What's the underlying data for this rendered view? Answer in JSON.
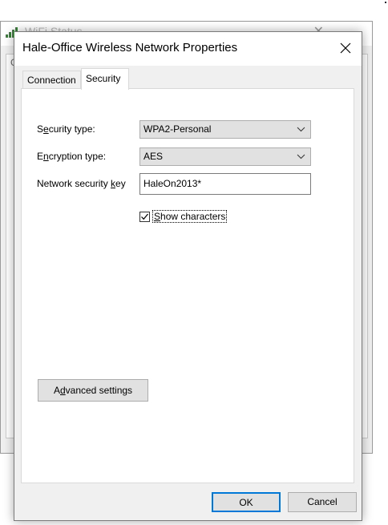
{
  "background_window": {
    "title": "WiFi Status",
    "tab_letter": "G"
  },
  "dialog": {
    "title": "Hale-Office Wireless Network Properties",
    "tabs": [
      {
        "label": "Connection",
        "selected": false
      },
      {
        "label": "Security",
        "selected": true
      }
    ],
    "security_type": {
      "label_pre": "S",
      "label_key": "e",
      "label_post": "curity type:",
      "value": "WPA2-Personal"
    },
    "encryption_type": {
      "label_pre": "E",
      "label_key": "n",
      "label_post": "cryption type:",
      "value": "AES"
    },
    "network_key": {
      "label_pre": "Network security ",
      "label_key": "k",
      "label_post": "ey",
      "value": "HaleOn2013*"
    },
    "show_characters": {
      "label_key": "S",
      "label_post": "how characters",
      "checked": true
    },
    "advanced_button": {
      "label_pre": "A",
      "label_key": "d",
      "label_post": "vanced settings"
    },
    "ok_label": "OK",
    "cancel_label": "Cancel"
  },
  "colors": {
    "dialog_bg": "#f0f0f0",
    "panel_bg": "#ffffff",
    "button_bg": "#e1e1e1",
    "focus_border": "#0078d7"
  }
}
